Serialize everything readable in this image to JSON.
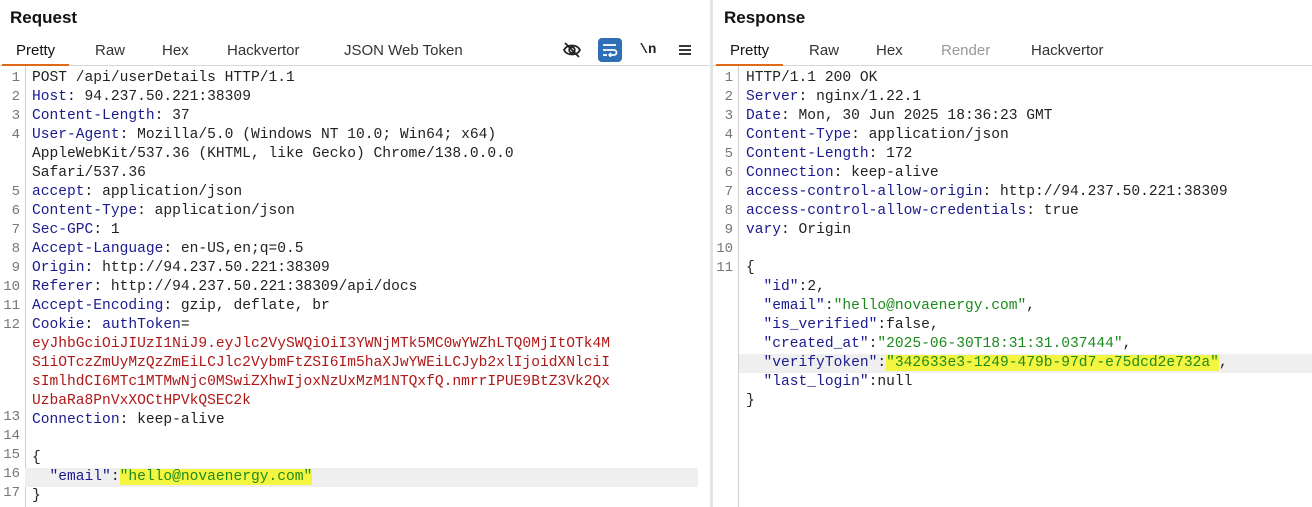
{
  "request": {
    "title": "Request",
    "tabs": [
      "Pretty",
      "Raw",
      "Hex",
      "Hackvertor",
      "JSON Web Token"
    ],
    "active_tab": "Pretty",
    "tools": [
      "eye-slash-icon",
      "wrap-lines-icon",
      "newline-icon",
      "menu-icon"
    ],
    "line_numbers": [
      "1",
      "2",
      "3",
      "4",
      "5",
      "6",
      "7",
      "8",
      "9",
      "10",
      "11",
      "12",
      "13",
      "14",
      "15",
      "16",
      "17"
    ],
    "request_line": "POST /api/userDetails HTTP/1.1",
    "headers": [
      {
        "name": "Host",
        "value": " 94.237.50.221:38309"
      },
      {
        "name": "Content-Length",
        "value": " 37"
      },
      {
        "name": "User-Agent",
        "value": " Mozilla/5.0 (Windows NT 10.0; Win64; x64)"
      },
      {
        "name": "accept",
        "value": " application/json"
      },
      {
        "name": "Content-Type",
        "value": " application/json"
      },
      {
        "name": "Sec-GPC",
        "value": " 1"
      },
      {
        "name": "Accept-Language",
        "value": " en-US,en;q=0.5"
      },
      {
        "name": "Origin",
        "value": " http://94.237.50.221:38309"
      },
      {
        "name": "Referer",
        "value": " http://94.237.50.221:38309/api/docs"
      },
      {
        "name": "Accept-Encoding",
        "value": " gzip, deflate, br"
      },
      {
        "name": "Cookie",
        "value": " "
      },
      {
        "name": "Connection",
        "value": " keep-alive"
      }
    ],
    "ua_wrap": [
      "AppleWebKit/537.36 (KHTML, like Gecko) Chrome/138.0.0.0",
      "Safari/537.36"
    ],
    "cookie_name": "authToken",
    "cookie_eq": "=",
    "cookie_wrap": [
      "eyJhbGciOiJIUzI1NiJ9.eyJlc2VySWQiOiI3YWNjMTk5MC0wYWZhLTQ0MjItOTk4M",
      "S1iOTczZmUyMzQzZmEiLCJlc2VybmFtZSI6Im5haXJwYWEiLCJyb2xlIjoidXNlciI",
      "sImlhdCI6MTc1MTMwNjc0MSwiZXhwIjoxNzUxMzM1NTQxfQ.nmrrIPUE9BtZ3Vk2Qx",
      "UzbaRa8PnVxXOCtHPVkQSEC2k"
    ],
    "body_open": "{",
    "body_key": "\"email\"",
    "body_colon": ":",
    "body_value": "\"hello@novaenergy.com\"",
    "body_close": "}"
  },
  "response": {
    "title": "Response",
    "tabs": [
      "Pretty",
      "Raw",
      "Hex",
      "Render",
      "Hackvertor"
    ],
    "active_tab": "Pretty",
    "line_numbers": [
      "1",
      "2",
      "3",
      "4",
      "5",
      "6",
      "7",
      "8",
      "9",
      "10",
      "11"
    ],
    "status_line": "HTTP/1.1 200 OK",
    "headers": [
      {
        "name": "Server",
        "value": " nginx/1.22.1"
      },
      {
        "name": "Date",
        "value": " Mon, 30 Jun 2025 18:36:23 GMT"
      },
      {
        "name": "Content-Type",
        "value": " application/json"
      },
      {
        "name": "Content-Length",
        "value": " 172"
      },
      {
        "name": "Connection",
        "value": " keep-alive"
      },
      {
        "name": "access-control-allow-origin",
        "value": " http://94.237.50.221:38309"
      },
      {
        "name": "access-control-allow-credentials",
        "value": " true"
      },
      {
        "name": "vary",
        "value": " Origin"
      }
    ],
    "json_open": "{",
    "json": [
      {
        "key": "\"id\"",
        "value": "2",
        "type": "num",
        "comma": ","
      },
      {
        "key": "\"email\"",
        "value": "\"hello@novaenergy.com\"",
        "type": "str",
        "comma": ","
      },
      {
        "key": "\"is_verified\"",
        "value": "false",
        "type": "num",
        "comma": ","
      },
      {
        "key": "\"created_at\"",
        "value": "\"2025-06-30T18:31:31.037444\"",
        "type": "str",
        "comma": ","
      },
      {
        "key": "\"verifyToken\"",
        "value": "\"342633e3-1249-479b-97d7-e75dcd2e732a\"",
        "type": "str",
        "comma": ",",
        "highlight": true
      },
      {
        "key": "\"last_login\"",
        "value": "null",
        "type": "num",
        "comma": ""
      }
    ],
    "json_close": "}"
  },
  "colors": {
    "accent": "#e06a1a",
    "highlight": "#f4f541",
    "header_key": "#1b1b8f",
    "cookie": "#b01818",
    "json_string": "#1c8a1c",
    "tool_active": "#2f6fb5"
  }
}
